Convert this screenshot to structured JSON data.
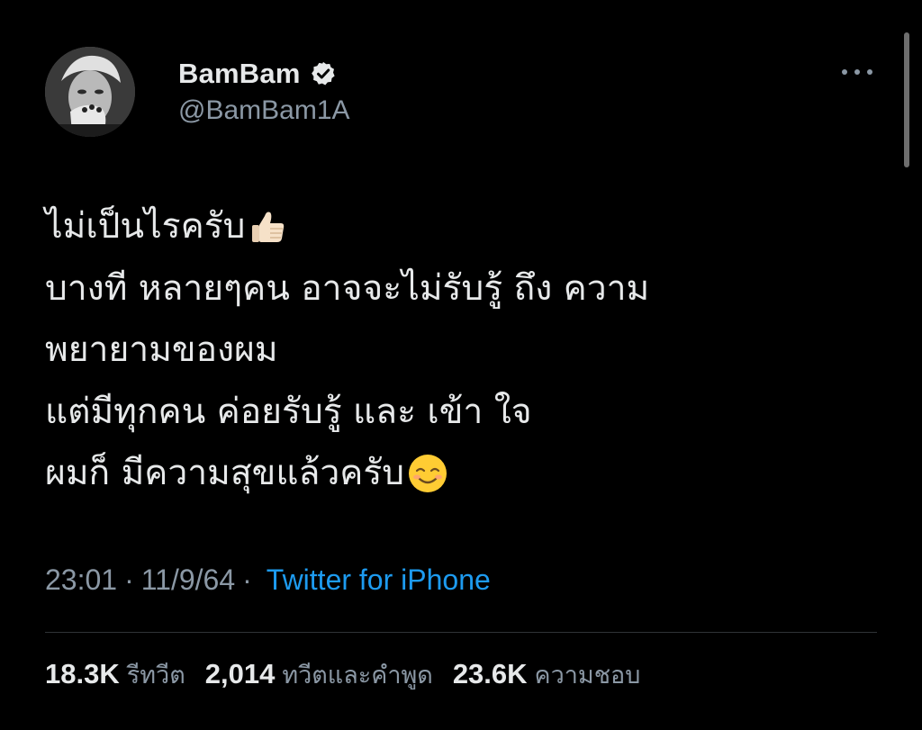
{
  "author": {
    "display_name": "BamBam",
    "handle": "@BamBam1A",
    "verified_icon": "verified-badge-icon",
    "avatar_icon": "profile-photo"
  },
  "menu": {
    "more_icon": "more-options-icon"
  },
  "tweet": {
    "lines": [
      "ไม่เป็นไรครับ",
      "บางที หลายๆคน อาจจะไม่รับรู้ ถึง ความ",
      "พยายามของผม",
      "แต่มีทุกคน ค่อยรับรู้ และ เข้า ใจ",
      "ผมก็ มีความสุขแล้วครับ"
    ],
    "emojis": [
      "thumbs-up-icon",
      "smiling-face-icon"
    ]
  },
  "meta": {
    "time": "23:01",
    "date": "11/9/64",
    "separator": "·",
    "source": "Twitter for iPhone"
  },
  "stats": {
    "retweets_count": "18.3K",
    "retweets_label": "รีทวีต",
    "quotes_count": "2,014",
    "quotes_label": "ทวีตและคำพูด",
    "likes_count": "23.6K",
    "likes_label": "ความชอบ"
  },
  "colors": {
    "background": "#000000",
    "text": "#e7e9ea",
    "secondary": "#8b98a5",
    "link": "#1d9bf0",
    "divider": "#2f3336"
  }
}
